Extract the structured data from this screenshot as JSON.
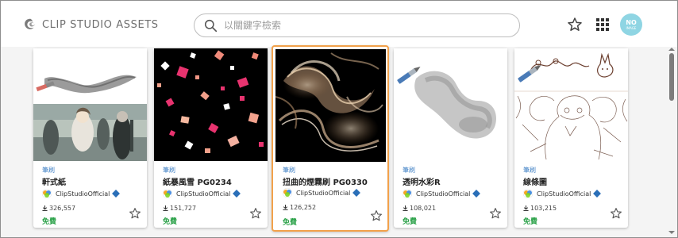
{
  "header": {
    "logo_text": "CLIP STUDIO ASSETS",
    "search_placeholder": "以關鍵字檢索",
    "avatar_line1": "NO",
    "avatar_line2": "IMAGE"
  },
  "colors": {
    "category": "#3f80c5",
    "free": "#2aa148",
    "selected_border": "#f2a14b",
    "avatar": "#8fd5e3"
  },
  "cards": [
    {
      "category": "筆刷",
      "title": "軒式紙",
      "author": "ClipStudioOfficial",
      "downloads": "326,557",
      "price": "免費",
      "thumb": "brush-stroke-and-painting"
    },
    {
      "category": "筆刷",
      "title": "紙暴風雪 PG0234",
      "author": "ClipStudioOfficial",
      "downloads": "151,727",
      "price": "免費",
      "thumb": "confetti"
    },
    {
      "category": "筆刷",
      "title": "扭曲的煙霧刷 PG0330",
      "author": "ClipStudioOfficial",
      "downloads": "126,252",
      "price": "免費",
      "thumb": "smoke",
      "selected": true
    },
    {
      "category": "筆刷",
      "title": "透明水彩R",
      "author": "ClipStudioOfficial",
      "downloads": "108,021",
      "price": "免費",
      "thumb": "watercolor"
    },
    {
      "category": "筆刷",
      "title": "線條圖",
      "author": "ClipStudioOfficial",
      "downloads": "103,215",
      "price": "免費",
      "thumb": "line-art"
    }
  ]
}
